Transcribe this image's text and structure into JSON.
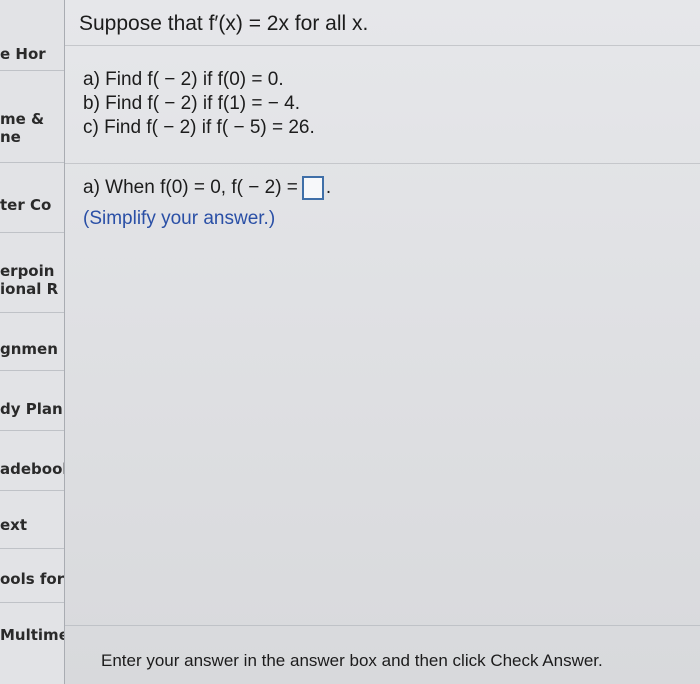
{
  "sidebar": {
    "items": [
      {
        "lines": [
          "e Hor"
        ]
      },
      {
        "lines": [
          "me &",
          "ne"
        ]
      },
      {
        "lines": [
          "ter Co"
        ]
      },
      {
        "lines": [
          "erpoin",
          "ional R"
        ]
      },
      {
        "lines": [
          "gnmen"
        ]
      },
      {
        "lines": [
          "dy Plan"
        ]
      },
      {
        "lines": [
          "adebook"
        ]
      },
      {
        "lines": [
          "ext"
        ]
      },
      {
        "lines": [
          "ools for Su"
        ]
      },
      {
        "lines": [
          "Multimedia"
        ]
      }
    ]
  },
  "question": {
    "title": "Suppose that f′(x) = 2x for all x.",
    "parts": [
      "a) Find f( − 2) if f(0) = 0.",
      "b) Find f( − 2) if f(1) = − 4.",
      "c) Find f( − 2) if f( − 5) = 26."
    ]
  },
  "answer": {
    "prompt": "a) When f(0) = 0, f( − 2) =",
    "value": "",
    "trailing": ".",
    "hint": "(Simplify your answer.)"
  },
  "footer": {
    "instruction": "Enter your answer in the answer box and then click Check Answer."
  },
  "colors": {
    "answer_box_border": "#3f6fa8",
    "hint_text": "#2a4fa6"
  }
}
